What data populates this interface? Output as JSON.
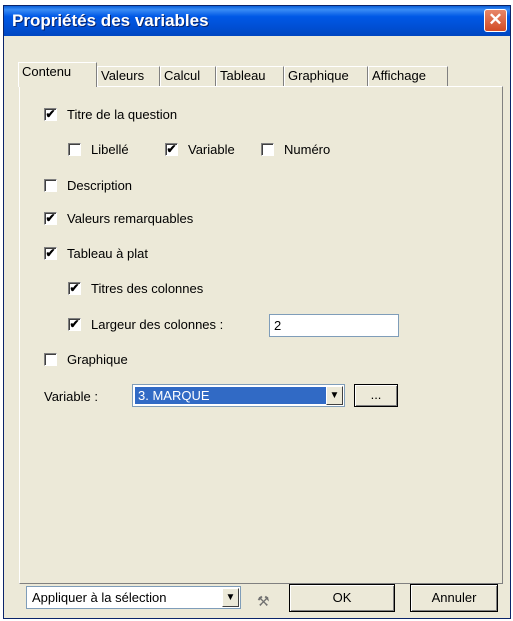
{
  "window": {
    "title": "Propriétés des variables"
  },
  "tabs": [
    {
      "label": "Contenu",
      "active": true
    },
    {
      "label": "Valeurs"
    },
    {
      "label": "Calcul"
    },
    {
      "label": "Tableau"
    },
    {
      "label": "Graphique"
    },
    {
      "label": "Affichage"
    }
  ],
  "options": {
    "titre_question": {
      "label": "Titre de la question",
      "checked": true
    },
    "libelle": {
      "label": "Libellé",
      "checked": false
    },
    "variable": {
      "label": "Variable",
      "checked": true
    },
    "numero": {
      "label": "Numéro",
      "checked": false
    },
    "description": {
      "label": "Description",
      "checked": false
    },
    "valeurs_remarquables": {
      "label": "Valeurs remarquables",
      "checked": true
    },
    "tableau_plat": {
      "label": "Tableau à plat",
      "checked": true
    },
    "titres_colonnes": {
      "label": "Titres des colonnes",
      "checked": true
    },
    "largeur_colonnes": {
      "label": "Largeur des colonnes :",
      "checked": true,
      "value": "2"
    },
    "graphique": {
      "label": "Graphique",
      "checked": false
    }
  },
  "variable_select": {
    "label": "Variable :",
    "value": "3. MARQUE",
    "browse_label": "..."
  },
  "footer": {
    "apply_select": "Appliquer à la sélection",
    "ok_label": "OK",
    "cancel_label": "Annuler"
  },
  "colors": {
    "selection": "#316AC5",
    "title_bar": "#0058E6",
    "dialog_bg": "#ECE9D8"
  },
  "icons": {
    "close": "close-icon",
    "tools": "tools-icon",
    "dropdown": "chevron-down-icon"
  }
}
